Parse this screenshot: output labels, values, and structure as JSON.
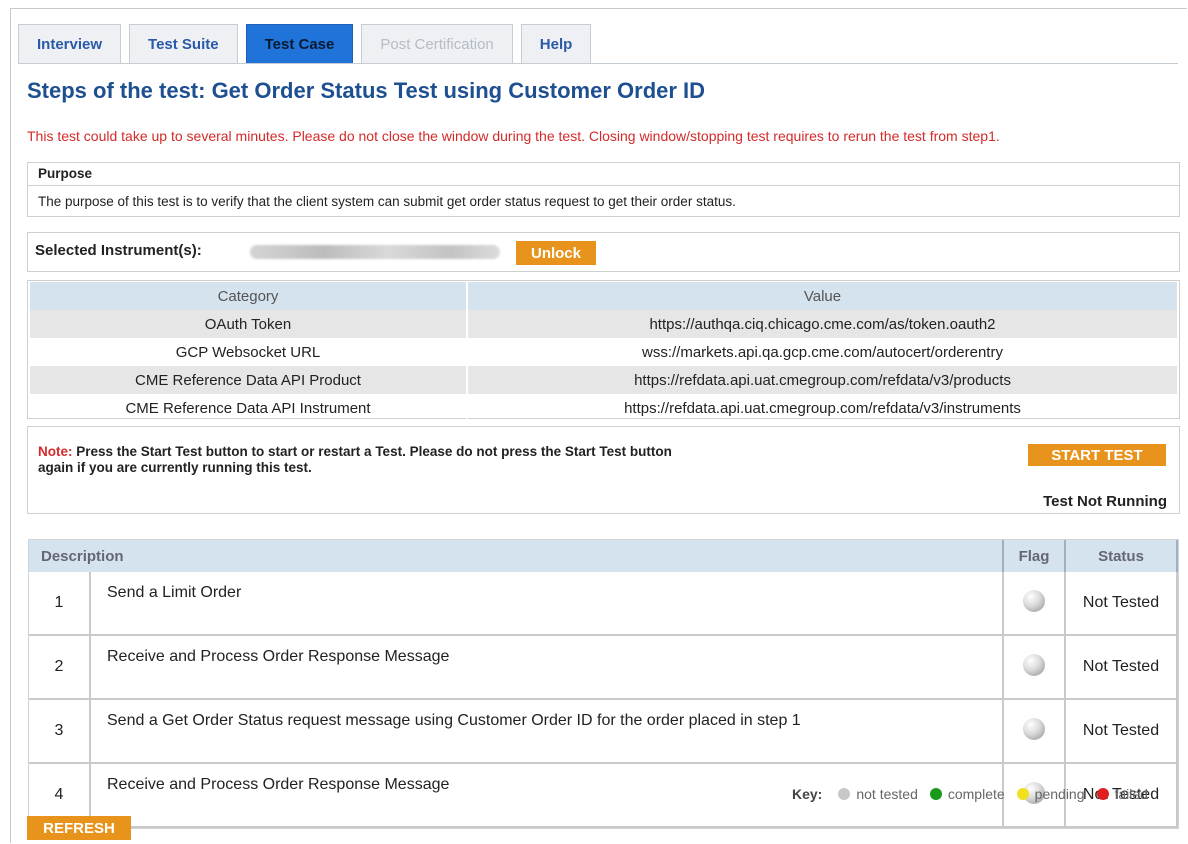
{
  "tabs": [
    {
      "label": "Interview"
    },
    {
      "label": "Test Suite"
    },
    {
      "label": "Test Case"
    },
    {
      "label": "Post Certification"
    },
    {
      "label": "Help"
    }
  ],
  "title": "Steps of the test: Get Order Status Test using Customer Order ID",
  "warning": "This test could take up to several minutes. Please do not close the window during the test. Closing window/stopping test requires to rerun the test from step1.",
  "purpose": {
    "heading": "Purpose",
    "text": "The purpose of this test is to verify that the client system can submit get order status request to get their order status."
  },
  "instrument": {
    "label": "Selected Instrument(s):",
    "unlock_label": "Unlock"
  },
  "config": {
    "headers": [
      "Category",
      "Value"
    ],
    "rows": [
      {
        "category": "OAuth Token",
        "value": "https://authqa.ciq.chicago.cme.com/as/token.oauth2"
      },
      {
        "category": "GCP Websocket URL",
        "value": "wss://markets.api.qa.gcp.cme.com/autocert/orderentry"
      },
      {
        "category": "CME Reference Data API Product",
        "value": "https://refdata.api.uat.cmegroup.com/refdata/v3/products"
      },
      {
        "category": "CME Reference Data API Instrument",
        "value": "https://refdata.api.uat.cmegroup.com/refdata/v3/instruments"
      }
    ]
  },
  "note": {
    "label": "Note:",
    "line1": " Press the Start Test button to start or restart a Test. Please do not press the Start Test button",
    "line2": "again if you are currently running this test.",
    "start_label": "START TEST",
    "status": "Test Not Running"
  },
  "steps": {
    "headers": [
      "Description",
      "Flag",
      "Status"
    ],
    "rows": [
      {
        "num": "1",
        "desc": "Send a Limit Order",
        "status": "Not Tested"
      },
      {
        "num": "2",
        "desc": "Receive and Process Order Response Message",
        "status": "Not Tested"
      },
      {
        "num": "3",
        "desc": "Send a Get Order Status request message using Customer Order ID for the order placed in step 1",
        "status": "Not Tested"
      },
      {
        "num": "4",
        "desc": "Receive and Process Order Response Message",
        "status": "Not Tested"
      }
    ]
  },
  "key": {
    "label": "Key:",
    "items": [
      {
        "label": "not tested",
        "color": "#c8c8c8"
      },
      {
        "label": "complete",
        "color": "#1a9a1a"
      },
      {
        "label": "pending",
        "color": "#f0e020"
      },
      {
        "label": "failed",
        "color": "#e02020"
      }
    ]
  },
  "refresh_label": "REFRESH"
}
